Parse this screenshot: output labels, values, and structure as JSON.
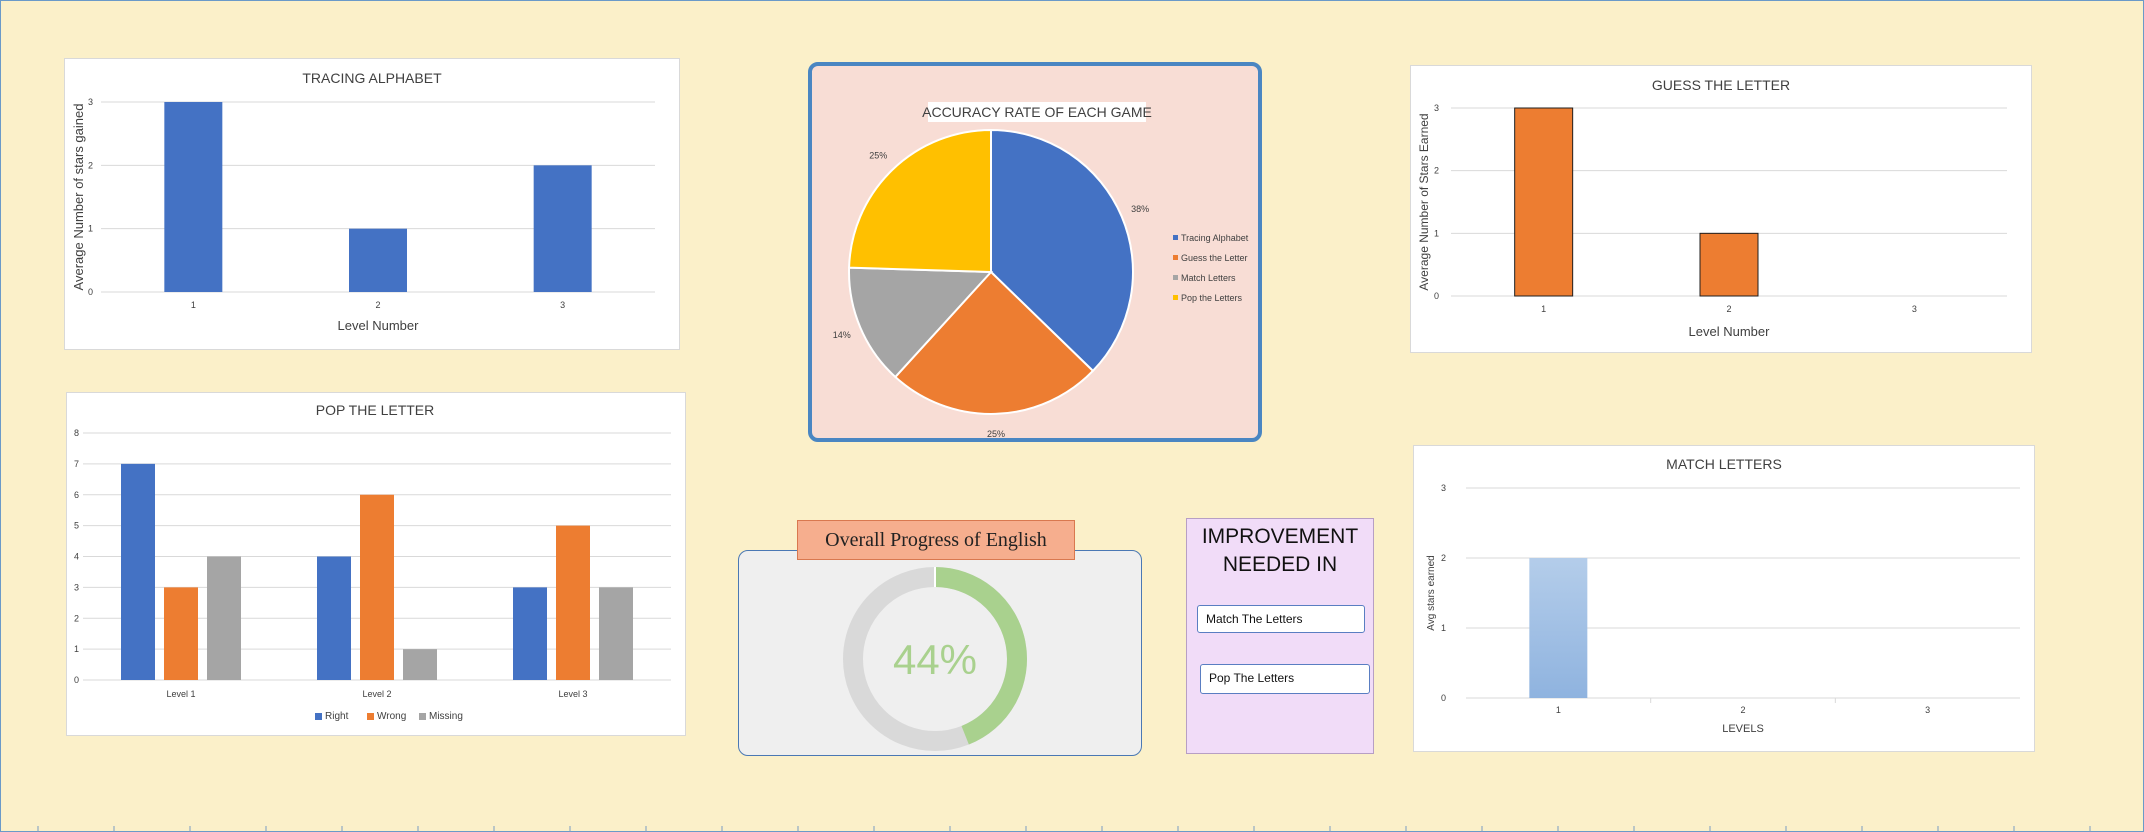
{
  "chart_data": [
    {
      "id": "tracing",
      "type": "bar",
      "title": "TRACING ALPHABET",
      "xlabel": "Level Number",
      "ylabel": "Average Number of stars gained",
      "categories": [
        "1",
        "2",
        "3"
      ],
      "values": [
        3,
        1,
        2
      ],
      "ylim": [
        0,
        3
      ],
      "yticks": [
        "0",
        "1",
        "2",
        "3"
      ],
      "color": "#4472c4",
      "grid": true
    },
    {
      "id": "guess",
      "type": "bar",
      "title": "GUESS THE LETTER",
      "xlabel": "Level Number",
      "ylabel": "Average Number of Stars Earned",
      "categories": [
        "1",
        "2",
        "3"
      ],
      "values": [
        3,
        1,
        0
      ],
      "ylim": [
        0,
        3
      ],
      "yticks": [
        "0",
        "1",
        "2",
        "3"
      ],
      "color": "#ed7d31",
      "grid": true
    },
    {
      "id": "pop",
      "type": "bar",
      "title": "POP THE LETTER",
      "categories": [
        "Level 1",
        "Level 2",
        "Level 3"
      ],
      "series": [
        {
          "name": "Right",
          "values": [
            7,
            4,
            3
          ],
          "color": "#4472c4"
        },
        {
          "name": "Wrong",
          "values": [
            3,
            6,
            5
          ],
          "color": "#ed7d31"
        },
        {
          "name": "Missing",
          "values": [
            4,
            1,
            3
          ],
          "color": "#a5a5a5"
        }
      ],
      "ylim": [
        0,
        8
      ],
      "yticks": [
        "0",
        "1",
        "2",
        "3",
        "4",
        "5",
        "6",
        "7",
        "8"
      ],
      "legend": "bottom",
      "grid": true
    },
    {
      "id": "match",
      "type": "bar",
      "title": "MATCH LETTERS",
      "xlabel": "LEVELS",
      "ylabel": "Avg stars earned",
      "categories": [
        "1",
        "2",
        "3"
      ],
      "values": [
        2,
        0,
        0
      ],
      "ylim": [
        0,
        3
      ],
      "yticks": [
        "0",
        "1",
        "2",
        "3"
      ],
      "color": "#a3c0e4",
      "grid": true
    },
    {
      "id": "accuracy",
      "type": "pie",
      "title": "ACCURACY RATE OF EACH GAME",
      "slices": [
        {
          "name": "Tracing Alphabet",
          "value": 38,
          "label": "38%",
          "color": "#4472c4"
        },
        {
          "name": "Guess the Letter",
          "value": 25,
          "label": "25%",
          "color": "#ed7d31"
        },
        {
          "name": "Match Letters",
          "value": 14,
          "label": "14%",
          "color": "#a5a5a5"
        },
        {
          "name": "Pop the Letters",
          "value": 25,
          "label": "25%",
          "color": "#ffc000"
        }
      ],
      "legend": "right"
    }
  ],
  "progress": {
    "title": "Overall Progress of English",
    "value_text": "44%",
    "fraction": 0.44,
    "color": "#a9d18e",
    "track_color": "#d9d9d9"
  },
  "improvement": {
    "title_line1": "IMPROVEMENT",
    "title_line2": "NEEDED IN",
    "items": [
      "Match The Letters",
      "Pop The Letters"
    ]
  }
}
